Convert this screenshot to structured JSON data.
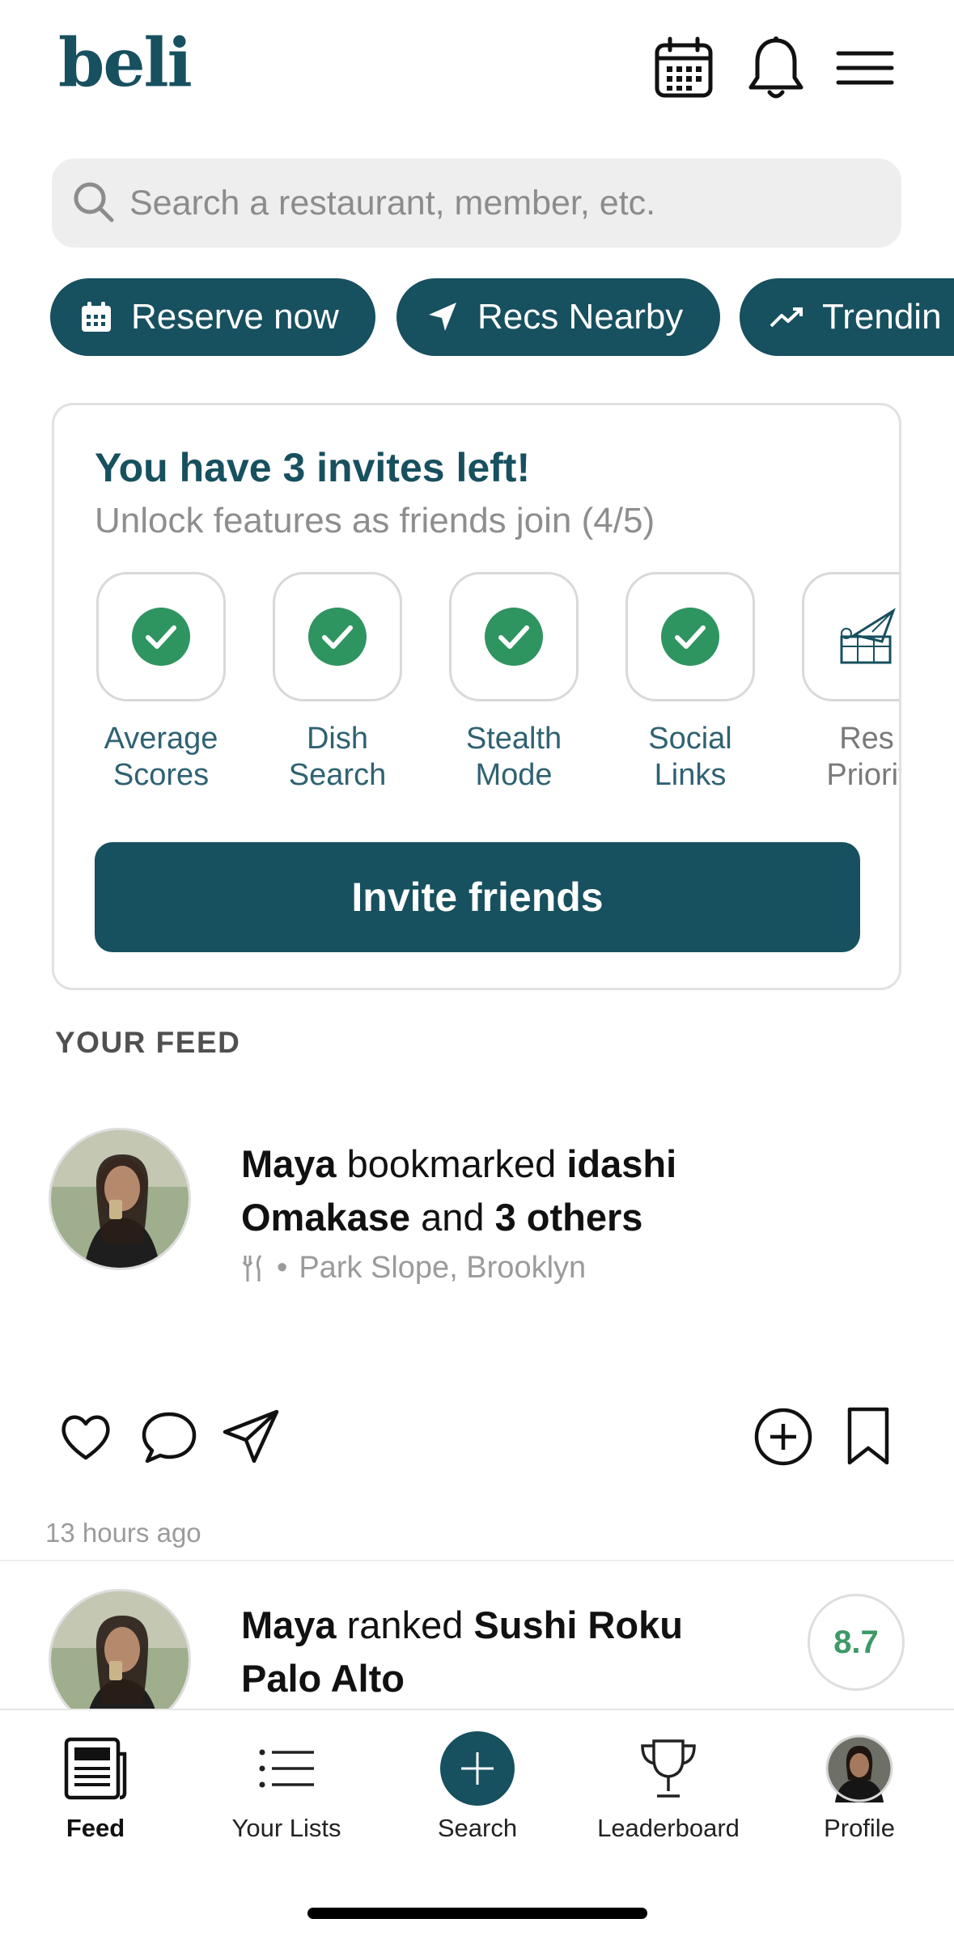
{
  "header": {
    "logo": "beli",
    "icons": [
      "calendar-icon",
      "bell-icon",
      "menu-icon"
    ]
  },
  "search": {
    "placeholder": "Search a restaurant, member, etc."
  },
  "chips": [
    {
      "label": "Reserve now",
      "icon": "calendar-icon"
    },
    {
      "label": "Recs Nearby",
      "icon": "navigation-arrow-icon"
    },
    {
      "label": "Trendin",
      "icon": "trending-up-icon"
    }
  ],
  "invite_card": {
    "title": "You have 3 invites left!",
    "subtitle": "Unlock features as friends join (4/5)",
    "features": [
      {
        "label": "Average\nScores",
        "unlocked": true
      },
      {
        "label": "Dish\nSearch",
        "unlocked": true
      },
      {
        "label": "Stealth\nMode",
        "unlocked": true
      },
      {
        "label": "Social\nLinks",
        "unlocked": true
      },
      {
        "label": "Res\nPriorit",
        "unlocked": false
      }
    ],
    "button": "Invite friends"
  },
  "feed": {
    "section_label": "YOUR FEED",
    "items": [
      {
        "user": "Maya",
        "verb": " bookmarked ",
        "place": "idashi Omakase",
        "connector": " and ",
        "extra": "3 others",
        "location": "Park Slope, Brooklyn",
        "separator": "•",
        "time": "13 hours ago"
      },
      {
        "user": "Maya",
        "verb": " ranked ",
        "place": "Sushi Roku Palo Alto",
        "score": "8.7"
      }
    ]
  },
  "tabbar": {
    "tabs": [
      {
        "label": "Feed",
        "active": true
      },
      {
        "label": "Your Lists",
        "active": false
      },
      {
        "label": "Search",
        "active": false
      },
      {
        "label": "Leaderboard",
        "active": false
      },
      {
        "label": "Profile",
        "active": false
      }
    ]
  },
  "colors": {
    "brand": "#17505f",
    "check": "#2e9460",
    "score": "#3d9a67"
  }
}
